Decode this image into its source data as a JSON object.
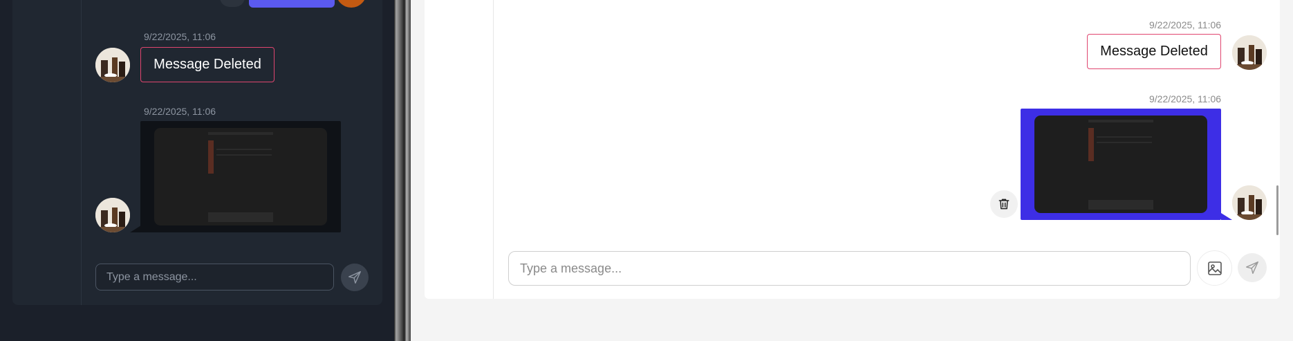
{
  "left_window": {
    "messages": [
      {
        "timestamp": "9/22/2025, 11:06",
        "text": "Message Deleted"
      },
      {
        "timestamp": "9/22/2025, 11:06",
        "attachment": "image"
      }
    ],
    "input": {
      "placeholder": "Type a message..."
    },
    "icons": {
      "send": "send-icon"
    }
  },
  "right_window": {
    "messages": [
      {
        "timestamp": "9/22/2025, 11:06",
        "text": "Message Deleted"
      },
      {
        "timestamp": "9/22/2025, 11:06",
        "attachment": "image"
      }
    ],
    "input": {
      "placeholder": "Type a message..."
    },
    "icons": {
      "delete": "trash-icon",
      "attach_image": "image-icon",
      "send": "send-icon"
    }
  },
  "colors": {
    "own_bubble": "#3d2ee6",
    "deleted_border": "#e0456f",
    "dark_bg": "#1b202a",
    "light_bg": "#ffffff"
  }
}
